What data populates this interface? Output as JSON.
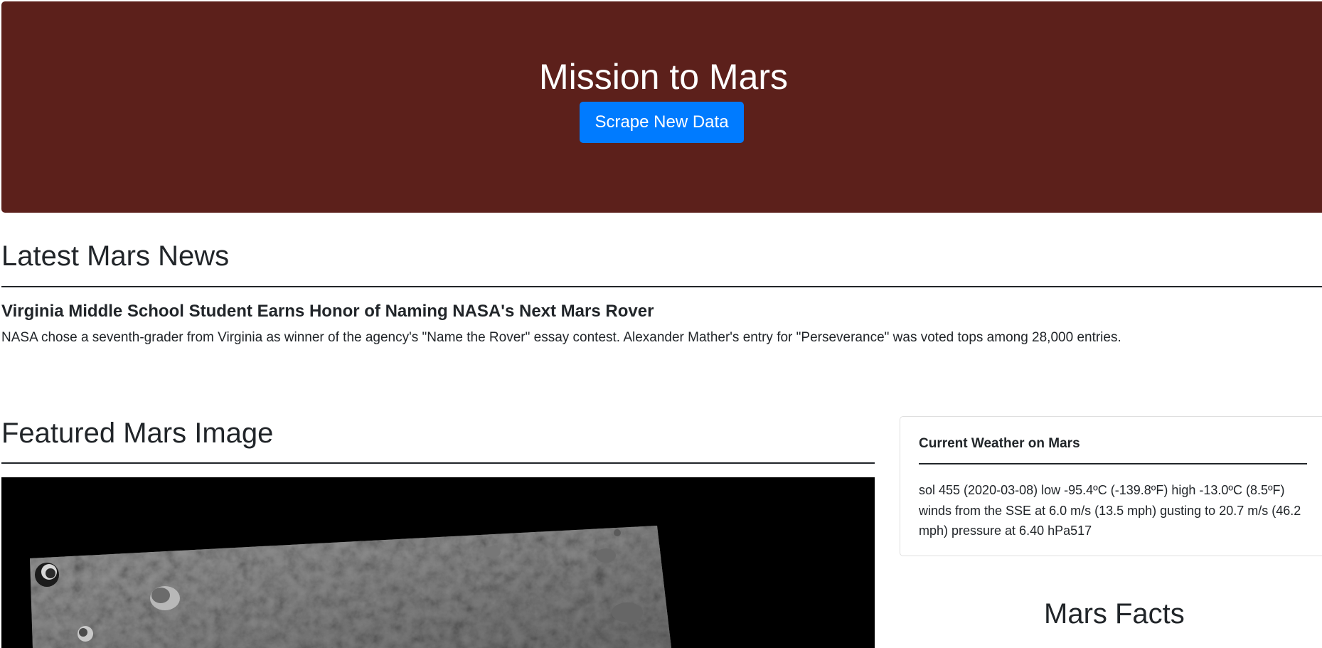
{
  "header": {
    "title": "Mission to Mars",
    "scrape_button_label": "Scrape New Data"
  },
  "news": {
    "section_title": "Latest Mars News",
    "headline": "Virginia Middle School Student Earns Honor of Naming NASA's Next Mars Rover",
    "teaser": "NASA chose a seventh-grader from Virginia as winner of the agency's \"Name the Rover\" essay contest. Alexander Mather's entry for \"Perseverance\" was voted tops among 28,000 entries."
  },
  "featured_image": {
    "section_title": "Featured Mars Image"
  },
  "weather": {
    "card_title": "Current Weather on Mars",
    "report": "sol 455 (2020-03-08) low -95.4ºC (-139.8ºF) high -13.0ºC (8.5ºF) winds from the SSE at 6.0 m/s (13.5 mph) gusting to 20.7 m/s (46.2 mph) pressure at 6.40 hPa517"
  },
  "facts": {
    "section_title": "Mars Facts"
  },
  "colors": {
    "jumbotron_bg": "#5c201b",
    "button_bg": "#007bff",
    "text": "#212529"
  }
}
